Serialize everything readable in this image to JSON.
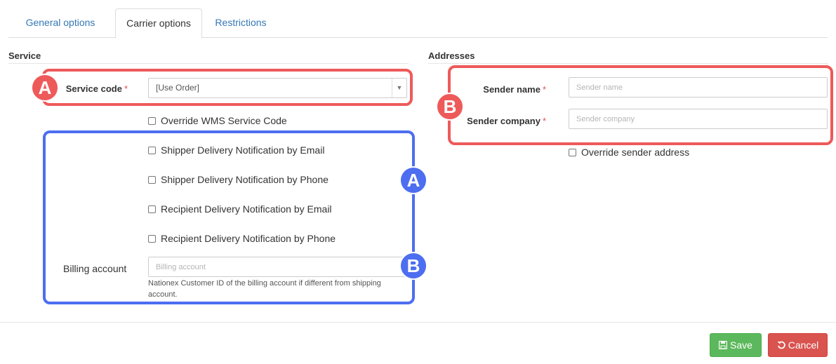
{
  "tabs": {
    "general": "General options",
    "carrier": "Carrier options",
    "restrictions": "Restrictions"
  },
  "service": {
    "title": "Service",
    "service_code_label": "Service code",
    "required_mark": "*",
    "service_code_value": "[Use Order]",
    "override_wms_label": "Override WMS Service Code",
    "notifications": [
      "Shipper Delivery Notification by Email",
      "Shipper Delivery Notification by Phone",
      "Recipient Delivery Notification by Email",
      "Recipient Delivery Notification by Phone"
    ],
    "billing_label": "Billing account",
    "billing_placeholder": "Billing account",
    "billing_help_1": "Nationex Customer ID of the billing account if different from shipping",
    "billing_help_2": "account."
  },
  "addresses": {
    "title": "Addresses",
    "sender_name_label": "Sender name",
    "sender_name_placeholder": "Sender name",
    "sender_company_label": "Sender company",
    "sender_company_placeholder": "Sender company",
    "override_sender_label": "Override sender address"
  },
  "annotations": {
    "badge_a": "A",
    "badge_b": "B",
    "red": "#ee5a5a",
    "blue": "#4d6ef0"
  },
  "footer": {
    "save_label": "Save",
    "cancel_label": "Cancel",
    "save_icon": "floppy-disk-icon",
    "cancel_icon": "undo-icon"
  }
}
